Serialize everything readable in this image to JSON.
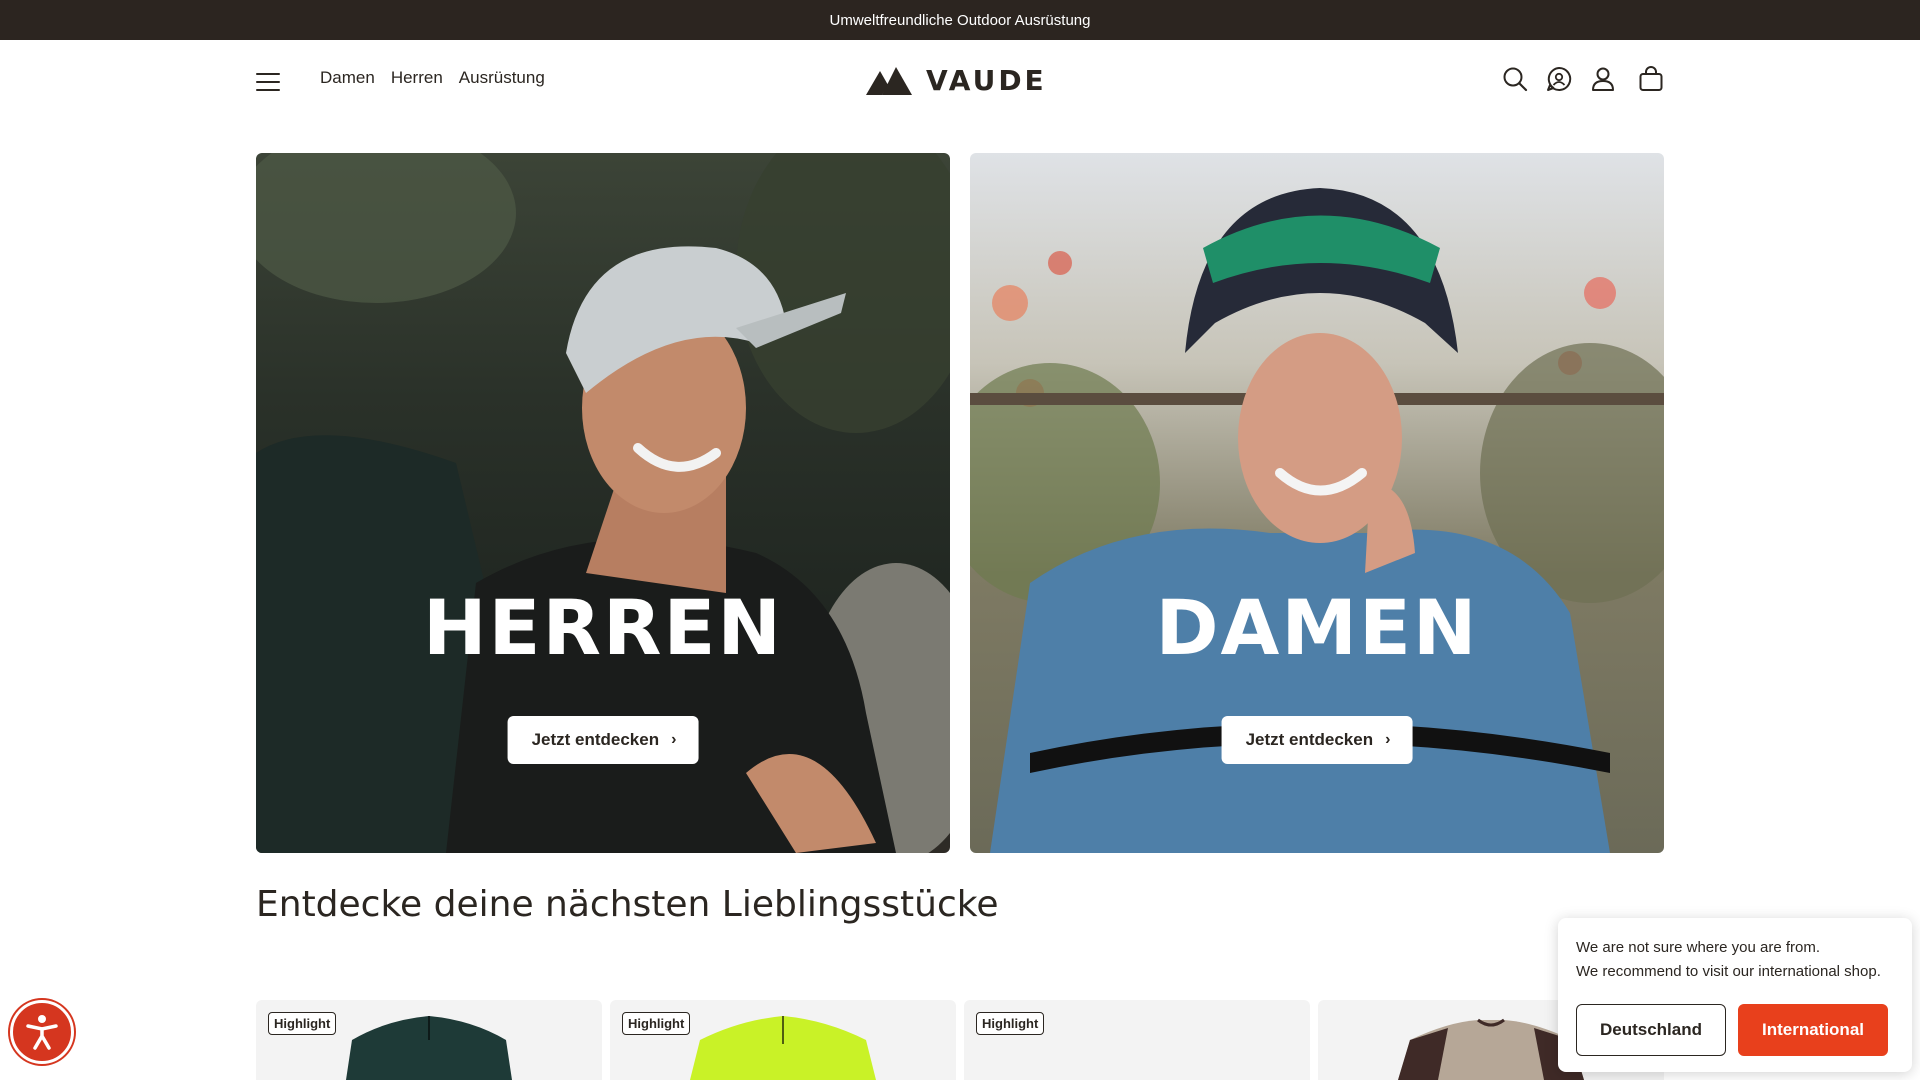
{
  "announcement": "Umweltfreundliche Outdoor Ausrüstung",
  "header": {
    "nav": [
      "Damen",
      "Herren",
      "Ausrüstung"
    ],
    "logo_text": "VAUDE",
    "icons": [
      "search-icon",
      "chat-support-icon",
      "account-icon",
      "shopping-bag-icon"
    ]
  },
  "heroes": [
    {
      "title": "HERREN",
      "cta": "Jetzt entdecken",
      "chevron": "›"
    },
    {
      "title": "DAMEN",
      "cta": "Jetzt entdecken",
      "chevron": "›"
    }
  ],
  "section": {
    "title": "Entdecke deine nächsten Lieblingsstücke"
  },
  "products": [
    {
      "badge": "Highlight",
      "color": "#1e3a37"
    },
    {
      "badge": "Highlight",
      "color": "#c9f227"
    },
    {
      "badge": "Highlight",
      "color": "#f3f3f3"
    },
    {
      "badge": "",
      "color": "#b6a797"
    }
  ],
  "geo_popup": {
    "line1": "We are not sure where you are from.",
    "line2": "We recommend to visit our international shop.",
    "btn_de": "Deutschland",
    "btn_intl": "International"
  },
  "colors": {
    "accent": "#e8401c",
    "topbar": "#2c2520",
    "a11y": "#d5361f"
  }
}
